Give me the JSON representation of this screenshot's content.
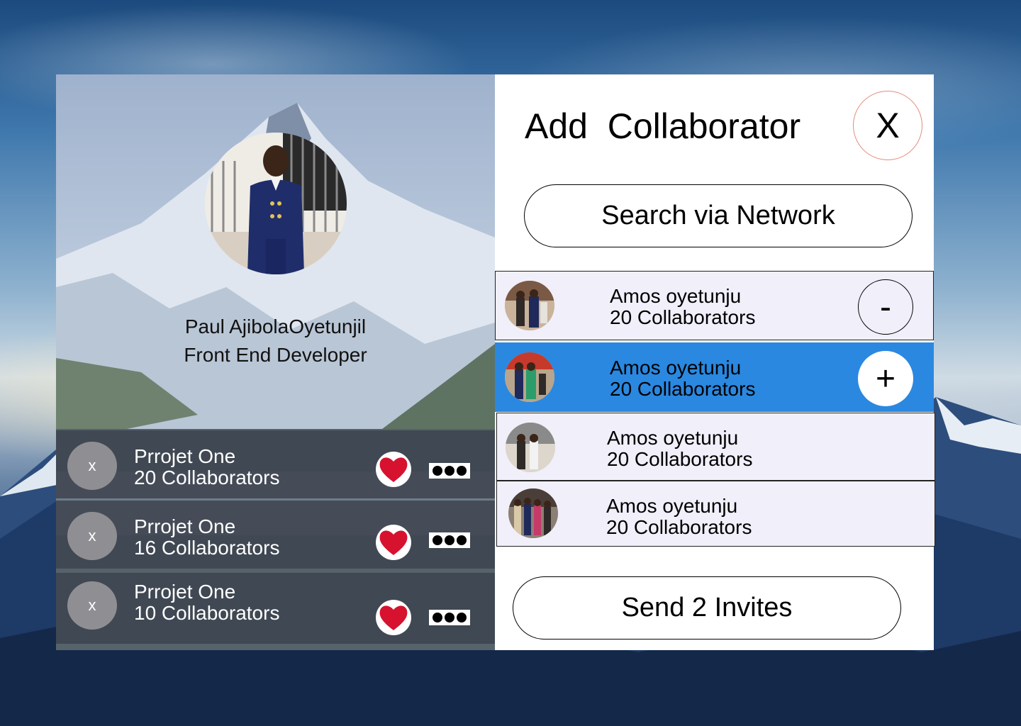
{
  "profile": {
    "name": "Paul AjibolaOyetunjil",
    "role": "Front End Developer"
  },
  "projects": [
    {
      "remove_label": "x",
      "title": "Prrojet One",
      "collaborators": "20 Collaborators"
    },
    {
      "remove_label": "x",
      "title": "Prrojet One",
      "collaborators": "16 Collaborators"
    },
    {
      "remove_label": "x",
      "title": "Prrojet One",
      "collaborators": "10 Collaborators"
    }
  ],
  "dialog": {
    "title": "Add  Collaborator",
    "close_label": "X",
    "search_label": "Search via Network",
    "send_label": "Send 2 Invites"
  },
  "collaborators": [
    {
      "name": "Amos oyetunju",
      "count": "20 Collaborators",
      "action": "-"
    },
    {
      "name": "Amos oyetunju",
      "count": "20 Collaborators",
      "action": "+"
    },
    {
      "name": "Amos oyetunju",
      "count": "20 Collaborators"
    },
    {
      "name": "Amos oyetunju",
      "count": "20 Collaborators"
    }
  ],
  "colors": {
    "selected_row": "#2a88e0",
    "row_background": "#f0effa",
    "heart": "#d6122f",
    "close_border": "#e58a7a"
  },
  "icons": {
    "like": "heart-icon",
    "more": "more-dots-icon",
    "remove": "minus-icon",
    "add": "plus-icon"
  }
}
